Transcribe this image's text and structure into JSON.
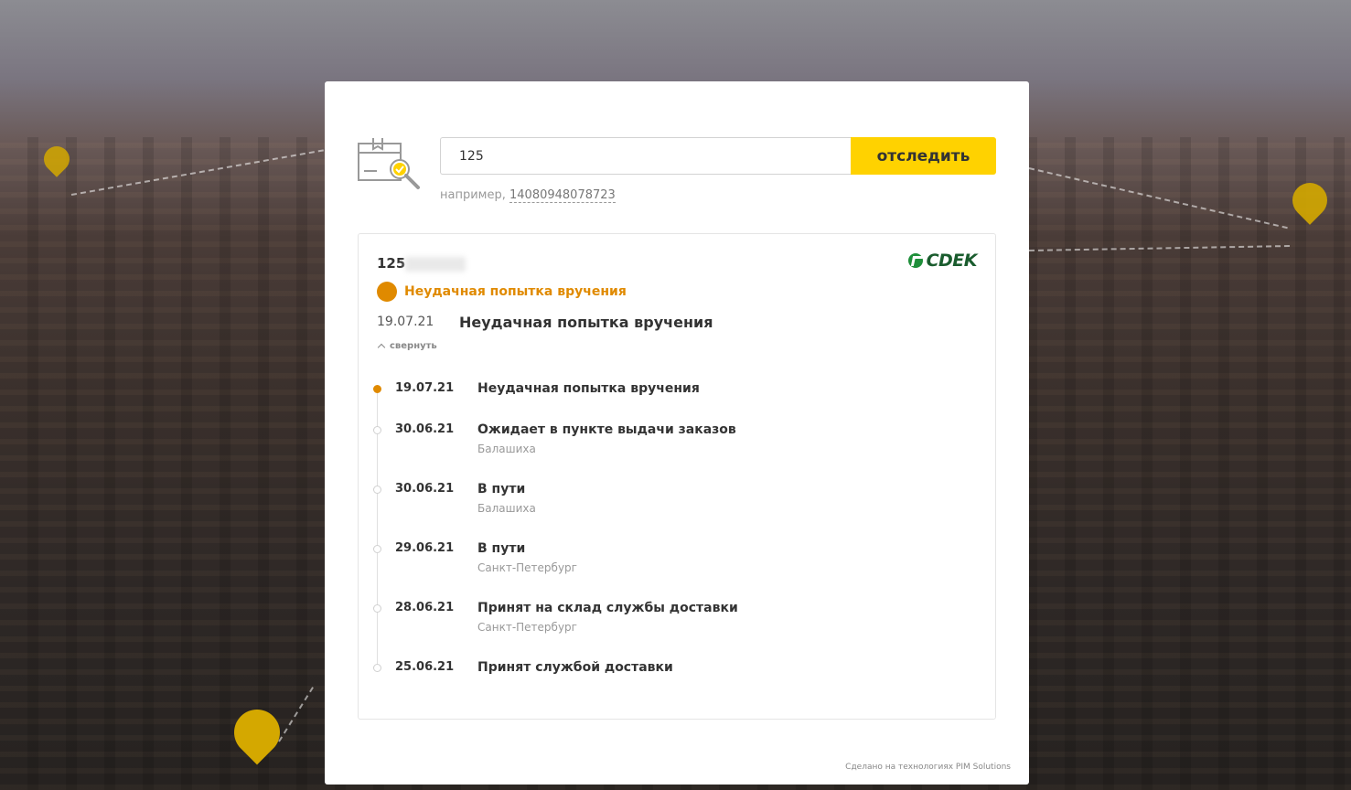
{
  "search": {
    "value": "125",
    "button_label": "отследить",
    "example_prefix": "например,",
    "example_number": "14080948078723"
  },
  "result": {
    "track_number": "125",
    "carrier_logo": "CDEK",
    "status": "Неудачная попытка вручения",
    "last_date": "19.07.21",
    "last_title": "Неудачная попытка вручения",
    "collapse_label": "свернуть",
    "events": [
      {
        "date": "19.07.21",
        "title": "Неудачная попытка вручения",
        "city": ""
      },
      {
        "date": "30.06.21",
        "title": "Ожидает в пункте выдачи заказов",
        "city": "Балашиха"
      },
      {
        "date": "30.06.21",
        "title": "В пути",
        "city": "Балашиха"
      },
      {
        "date": "29.06.21",
        "title": "В пути",
        "city": "Санкт-Петербург"
      },
      {
        "date": "28.06.21",
        "title": "Принят на склад службы доставки",
        "city": "Санкт-Петербург"
      },
      {
        "date": "25.06.21",
        "title": "Принят службой доставки",
        "city": ""
      }
    ]
  },
  "footer": {
    "text": "Сделано на технологиях PIM Solutions"
  },
  "colors": {
    "accent": "#ffd200",
    "status": "#e08a00",
    "carrier": "#1a5c2e",
    "pin": "#d4a800"
  }
}
